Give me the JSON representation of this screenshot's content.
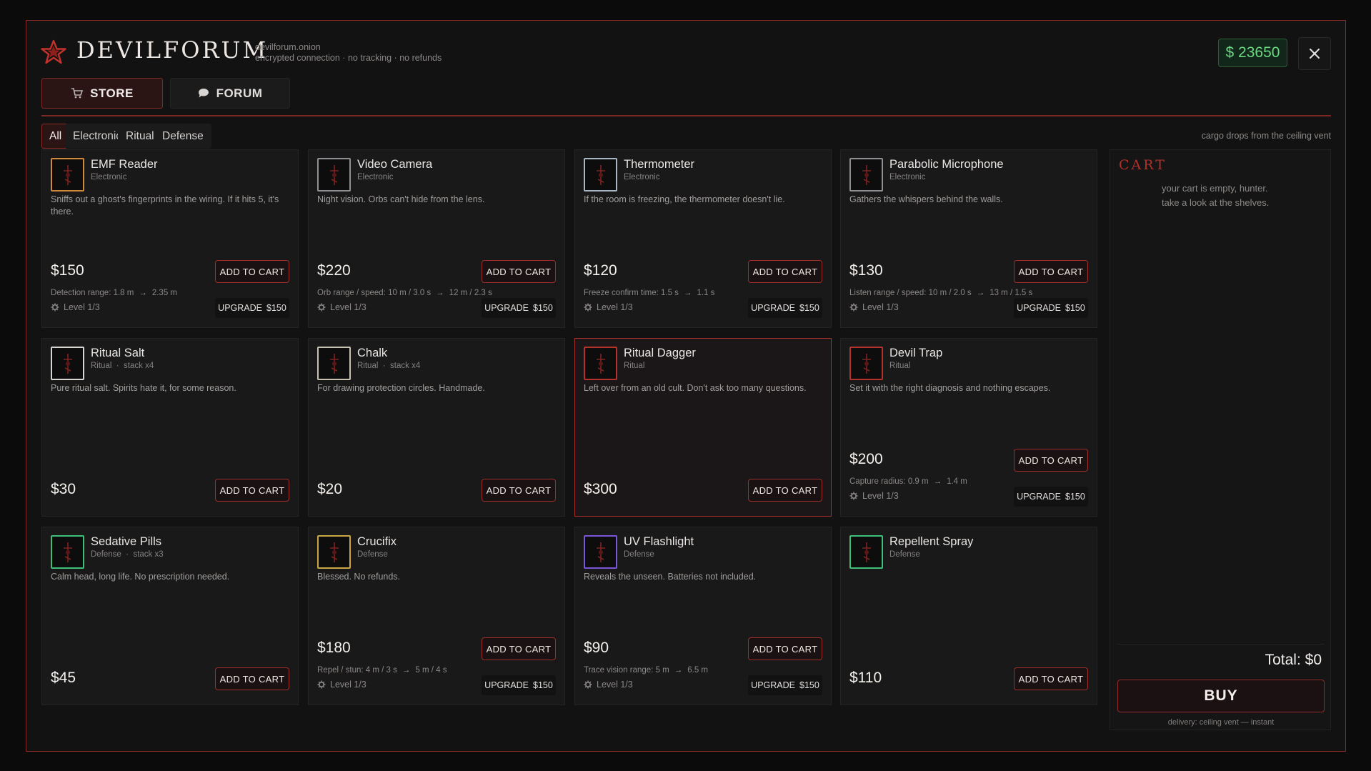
{
  "header": {
    "brand": "DEVILFORUM",
    "domain": "devilforum.onion",
    "tagline": "encrypted connection · no tracking · no refunds",
    "balance": "$ 23650"
  },
  "tabs": [
    {
      "label": "STORE",
      "icon": "shop-cart-icon"
    },
    {
      "label": "FORUM",
      "icon": "chat-bubble-icon"
    }
  ],
  "filters": [
    "All",
    "Electronic",
    "Ritual",
    "Defense"
  ],
  "delivery_note": "cargo drops from the ceiling vent",
  "items": [
    {
      "name": "EMF Reader",
      "category": "Electronic",
      "description": "Sniffs out a ghost's fingerprints in the wiring. If it hits 5, it's there.",
      "price": "$150",
      "stat": "Detection range: 1.8 m",
      "stat_next": "2.35 m",
      "level": "Level 1/3",
      "upgrade_label": "UPGRADE",
      "upgrade_price": "$150",
      "border": "#d08a3c",
      "icon": "emf-reader-icon"
    },
    {
      "name": "Video Camera",
      "category": "Electronic",
      "description": "Night vision. Orbs can't hide from the lens.",
      "price": "$220",
      "stat": "Orb range / speed: 10 m / 3.0 s",
      "stat_next": "12 m / 2.3 s",
      "level": "Level 1/3",
      "upgrade_label": "UPGRADE",
      "upgrade_price": "$150",
      "border": "#8f8f94",
      "icon": "video-camera-icon"
    },
    {
      "name": "Thermometer",
      "category": "Electronic",
      "description": "If the room is freezing, the thermometer doesn't lie.",
      "price": "$120",
      "stat": "Freeze confirm time: 1.5 s",
      "stat_next": "1.1 s",
      "level": "Level 1/3",
      "upgrade_label": "UPGRADE",
      "upgrade_price": "$150",
      "border": "#a9b6c4",
      "icon": "thermometer-icon"
    },
    {
      "name": "Parabolic Microphone",
      "category": "Electronic",
      "description": "Gathers the whispers behind the walls.",
      "price": "$130",
      "stat": "Listen range / speed: 10 m / 2.0 s",
      "stat_next": "13 m / 1.5 s",
      "level": "Level 1/3",
      "upgrade_label": "UPGRADE",
      "upgrade_price": "$150",
      "border": "#8f8f94",
      "icon": "parabolic-microphone-icon"
    },
    {
      "name": "Ritual Salt",
      "category": "Ritual",
      "stack": "stack x4",
      "description": "Pure ritual salt. Spirits hate it, for some reason.",
      "price": "$30",
      "border": "#d9d6d2",
      "icon": "salt-icon"
    },
    {
      "name": "Chalk",
      "category": "Ritual",
      "stack": "stack x4",
      "description": "For drawing protection circles. Handmade.",
      "price": "$20",
      "border": "#c9c2b0",
      "icon": "chalk-icon"
    },
    {
      "name": "Ritual Dagger",
      "category": "Ritual",
      "description": "Left over from an old cult. Don't ask too many questions.",
      "price": "$300",
      "border": "#b4332d",
      "icon": "dagger-icon"
    },
    {
      "name": "Devil Trap",
      "category": "Ritual",
      "description": "Set it with the right diagnosis and nothing escapes.",
      "price": "$200",
      "stat": "Capture radius: 0.9 m",
      "stat_next": "1.4 m",
      "level": "Level 1/3",
      "upgrade_label": "UPGRADE",
      "upgrade_price": "$150",
      "border": "#b4332d",
      "icon": "devil-trap-icon"
    },
    {
      "name": "Sedative Pills",
      "category": "Defense",
      "stack": "stack x3",
      "description": "Calm head, long life. No prescription needed.",
      "price": "$45",
      "border": "#3fbf77",
      "icon": "pills-icon"
    },
    {
      "name": "Crucifix",
      "category": "Defense",
      "description": "Blessed. No refunds.",
      "price": "$180",
      "stat": "Repel / stun: 4 m / 3 s",
      "stat_next": "5 m / 4 s",
      "level": "Level 1/3",
      "upgrade_label": "UPGRADE",
      "upgrade_price": "$150",
      "border": "#c9a544",
      "icon": "crucifix-icon"
    },
    {
      "name": "UV Flashlight",
      "category": "Defense",
      "description": "Reveals the unseen. Batteries not included.",
      "price": "$90",
      "stat": "Trace vision range: 5 m",
      "stat_next": "6.5 m",
      "level": "Level 1/3",
      "upgrade_label": "UPGRADE",
      "upgrade_price": "$150",
      "border": "#7b56d6",
      "icon": "uv-flashlight-icon"
    },
    {
      "name": "Repellent Spray",
      "category": "Defense",
      "description": "",
      "price": "$110",
      "border": "#3fbf77",
      "icon": "spray-can-icon"
    }
  ],
  "add_label": "ADD TO CART",
  "cart": {
    "title": "CART",
    "empty_line1": "your cart is empty, hunter.",
    "empty_line2": "take a look at the shelves.",
    "total": "Total: $0",
    "buy_label": "BUY",
    "delivery": "delivery: ceiling vent — instant"
  },
  "colors": {
    "accent": "#a8302a",
    "balance": "#69d982",
    "panel": "#19191a"
  }
}
